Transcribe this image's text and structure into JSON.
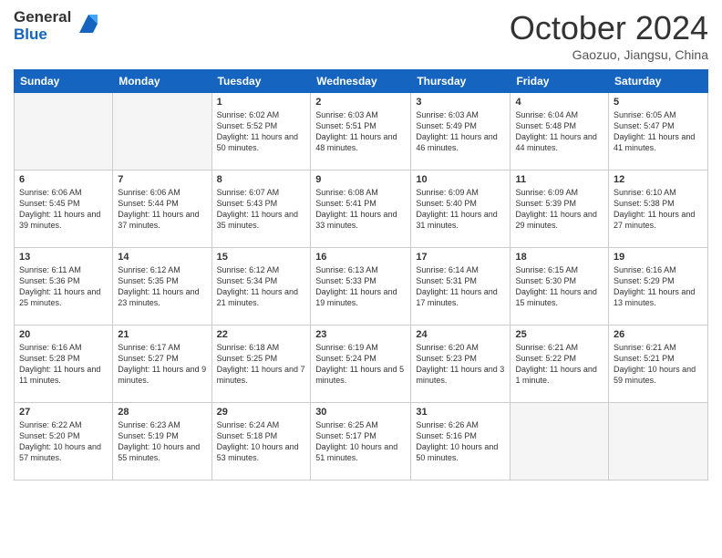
{
  "header": {
    "logo_line1": "General",
    "logo_line2": "Blue",
    "month": "October 2024",
    "location": "Gaozuo, Jiangsu, China"
  },
  "weekdays": [
    "Sunday",
    "Monday",
    "Tuesday",
    "Wednesday",
    "Thursday",
    "Friday",
    "Saturday"
  ],
  "weeks": [
    [
      {
        "day": "",
        "info": ""
      },
      {
        "day": "",
        "info": ""
      },
      {
        "day": "1",
        "info": "Sunrise: 6:02 AM\nSunset: 5:52 PM\nDaylight: 11 hours\nand 50 minutes."
      },
      {
        "day": "2",
        "info": "Sunrise: 6:03 AM\nSunset: 5:51 PM\nDaylight: 11 hours\nand 48 minutes."
      },
      {
        "day": "3",
        "info": "Sunrise: 6:03 AM\nSunset: 5:49 PM\nDaylight: 11 hours\nand 46 minutes."
      },
      {
        "day": "4",
        "info": "Sunrise: 6:04 AM\nSunset: 5:48 PM\nDaylight: 11 hours\nand 44 minutes."
      },
      {
        "day": "5",
        "info": "Sunrise: 6:05 AM\nSunset: 5:47 PM\nDaylight: 11 hours\nand 41 minutes."
      }
    ],
    [
      {
        "day": "6",
        "info": "Sunrise: 6:06 AM\nSunset: 5:45 PM\nDaylight: 11 hours\nand 39 minutes."
      },
      {
        "day": "7",
        "info": "Sunrise: 6:06 AM\nSunset: 5:44 PM\nDaylight: 11 hours\nand 37 minutes."
      },
      {
        "day": "8",
        "info": "Sunrise: 6:07 AM\nSunset: 5:43 PM\nDaylight: 11 hours\nand 35 minutes."
      },
      {
        "day": "9",
        "info": "Sunrise: 6:08 AM\nSunset: 5:41 PM\nDaylight: 11 hours\nand 33 minutes."
      },
      {
        "day": "10",
        "info": "Sunrise: 6:09 AM\nSunset: 5:40 PM\nDaylight: 11 hours\nand 31 minutes."
      },
      {
        "day": "11",
        "info": "Sunrise: 6:09 AM\nSunset: 5:39 PM\nDaylight: 11 hours\nand 29 minutes."
      },
      {
        "day": "12",
        "info": "Sunrise: 6:10 AM\nSunset: 5:38 PM\nDaylight: 11 hours\nand 27 minutes."
      }
    ],
    [
      {
        "day": "13",
        "info": "Sunrise: 6:11 AM\nSunset: 5:36 PM\nDaylight: 11 hours\nand 25 minutes."
      },
      {
        "day": "14",
        "info": "Sunrise: 6:12 AM\nSunset: 5:35 PM\nDaylight: 11 hours\nand 23 minutes."
      },
      {
        "day": "15",
        "info": "Sunrise: 6:12 AM\nSunset: 5:34 PM\nDaylight: 11 hours\nand 21 minutes."
      },
      {
        "day": "16",
        "info": "Sunrise: 6:13 AM\nSunset: 5:33 PM\nDaylight: 11 hours\nand 19 minutes."
      },
      {
        "day": "17",
        "info": "Sunrise: 6:14 AM\nSunset: 5:31 PM\nDaylight: 11 hours\nand 17 minutes."
      },
      {
        "day": "18",
        "info": "Sunrise: 6:15 AM\nSunset: 5:30 PM\nDaylight: 11 hours\nand 15 minutes."
      },
      {
        "day": "19",
        "info": "Sunrise: 6:16 AM\nSunset: 5:29 PM\nDaylight: 11 hours\nand 13 minutes."
      }
    ],
    [
      {
        "day": "20",
        "info": "Sunrise: 6:16 AM\nSunset: 5:28 PM\nDaylight: 11 hours\nand 11 minutes."
      },
      {
        "day": "21",
        "info": "Sunrise: 6:17 AM\nSunset: 5:27 PM\nDaylight: 11 hours\nand 9 minutes."
      },
      {
        "day": "22",
        "info": "Sunrise: 6:18 AM\nSunset: 5:25 PM\nDaylight: 11 hours\nand 7 minutes."
      },
      {
        "day": "23",
        "info": "Sunrise: 6:19 AM\nSunset: 5:24 PM\nDaylight: 11 hours\nand 5 minutes."
      },
      {
        "day": "24",
        "info": "Sunrise: 6:20 AM\nSunset: 5:23 PM\nDaylight: 11 hours\nand 3 minutes."
      },
      {
        "day": "25",
        "info": "Sunrise: 6:21 AM\nSunset: 5:22 PM\nDaylight: 11 hours\nand 1 minute."
      },
      {
        "day": "26",
        "info": "Sunrise: 6:21 AM\nSunset: 5:21 PM\nDaylight: 10 hours\nand 59 minutes."
      }
    ],
    [
      {
        "day": "27",
        "info": "Sunrise: 6:22 AM\nSunset: 5:20 PM\nDaylight: 10 hours\nand 57 minutes."
      },
      {
        "day": "28",
        "info": "Sunrise: 6:23 AM\nSunset: 5:19 PM\nDaylight: 10 hours\nand 55 minutes."
      },
      {
        "day": "29",
        "info": "Sunrise: 6:24 AM\nSunset: 5:18 PM\nDaylight: 10 hours\nand 53 minutes."
      },
      {
        "day": "30",
        "info": "Sunrise: 6:25 AM\nSunset: 5:17 PM\nDaylight: 10 hours\nand 51 minutes."
      },
      {
        "day": "31",
        "info": "Sunrise: 6:26 AM\nSunset: 5:16 PM\nDaylight: 10 hours\nand 50 minutes."
      },
      {
        "day": "",
        "info": ""
      },
      {
        "day": "",
        "info": ""
      }
    ]
  ]
}
